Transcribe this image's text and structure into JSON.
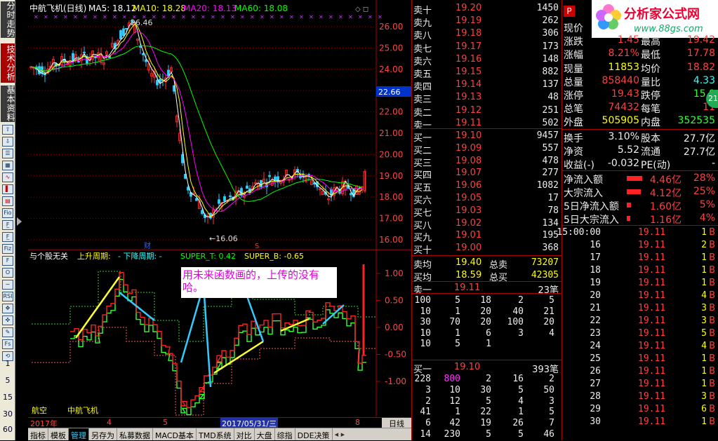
{
  "sidebar": {
    "tab_fenshi": "分时走势",
    "tab_jishu": "技术分析",
    "tab_jiben": "基本资料",
    "icons": [
      "up-arrow-icon",
      "down-arrow-icon",
      "list-icon",
      "grid-icon",
      "trend-icon",
      "candle-icon",
      "calculator-icon",
      "fio-icon",
      "fo-icon",
      "f-icon",
      "fiz-icon",
      "f-chart-icon",
      "circle-icon",
      "wave-icon",
      "rsi-icon",
      "cross-icon",
      "cross2-icon",
      "pencil-icon",
      "fs-icon",
      "refresh-icon"
    ],
    "icon_labels": [
      "⇧",
      "⇩",
      "☰",
      "▦",
      "∿",
      "▌",
      "▤",
      "Fio",
      "F̲",
      "F̲",
      "Fiz",
      "F",
      "O",
      "∽",
      "RSI",
      "✥",
      "✜",
      "✎",
      "Fs",
      "⟲"
    ],
    "numbers": [
      "1",
      "5",
      "15",
      "30",
      "60"
    ]
  },
  "kline": {
    "title": "中航飞机(日线)",
    "ma5": "MA5: 18.12",
    "ma10": "MA10: 18.28",
    "ma20": "MA20: 18.13",
    "ma60": "MA60: 18.08",
    "colors": {
      "ma5": "#ffffff",
      "ma10": "#ffff00",
      "ma20": "#ff00ff",
      "ma60": "#00ff00"
    },
    "high_label": "26.46",
    "low_label": "←16.06",
    "current_price": "22.66",
    "y_ticks": [
      "26.00",
      "25.00",
      "24.00",
      "23.00",
      "22.00",
      "21.00",
      "20.00",
      "19.00",
      "18.00",
      "17.00",
      "16.00"
    ],
    "fin_marker": "财",
    "s_marker": "S"
  },
  "indicator": {
    "title": "与个股无关",
    "up_label": "上升周期:",
    "down_label": "- 下降周期: -",
    "super_t": "SUPER_T: 0.42",
    "super_b": "SUPER_B: -0.65",
    "y_ticks": [
      "1.00",
      "0.50",
      "0.00",
      "-0.50",
      "-1.00"
    ],
    "annotation": "用未来函数画的，上传的没有哈。",
    "sector": "航空",
    "stock": "中航飞机"
  },
  "ruler": {
    "year": "2017年",
    "m4": "4",
    "m5": "5",
    "date": "2017/05/31/三",
    "m8": "8",
    "period": "日线"
  },
  "tabs": [
    "指标",
    "模板",
    "管理",
    "另存为",
    "私募数据",
    "MACD基本",
    "TMD系统",
    "对比",
    "大盘",
    "综指",
    "DDE决策"
  ],
  "active_tab": "管理",
  "orderbook": {
    "asks": [
      [
        "卖十",
        "19.20",
        "1450"
      ],
      [
        "卖九",
        "19.19",
        "262"
      ],
      [
        "卖八",
        "19.18",
        "306"
      ],
      [
        "卖七",
        "19.17",
        "173"
      ],
      [
        "卖六",
        "19.16",
        "148"
      ],
      [
        "卖五",
        "19.15",
        "882"
      ],
      [
        "卖四",
        "19.14",
        "137"
      ],
      [
        "卖三",
        "19.13",
        "48"
      ],
      [
        "卖二",
        "19.12",
        "251"
      ],
      [
        "卖一",
        "19.11",
        "502"
      ]
    ],
    "bids": [
      [
        "买一",
        "19.10",
        "9457"
      ],
      [
        "买二",
        "19.09",
        "557"
      ],
      [
        "买三",
        "19.08",
        "478"
      ],
      [
        "买四",
        "19.07",
        "277"
      ],
      [
        "买五",
        "19.06",
        "1082"
      ],
      [
        "买六",
        "19.05",
        "17"
      ],
      [
        "买七",
        "19.03",
        "78"
      ],
      [
        "买八",
        "19.02",
        "134"
      ],
      [
        "买九",
        "19.01",
        "195"
      ],
      [
        "买十",
        "19.00",
        "368"
      ]
    ],
    "avg_sell_label": "卖均",
    "avg_sell": "19.40",
    "total_sell_label": "总卖",
    "total_sell": "73207",
    "avg_buy_label": "买均",
    "avg_buy": "18.59",
    "total_buy_label": "总买",
    "total_buy": "42305",
    "ask1_label": "卖一",
    "ask1_price": "19.11",
    "ask1_count": "23笔",
    "ask1_queue": [
      [
        "100",
        "5",
        "18",
        "2",
        "5"
      ],
      [
        "10",
        "1",
        "20",
        "40",
        "21"
      ],
      [
        "30",
        "70",
        "20",
        "100",
        "20"
      ],
      [
        "10",
        "1",
        "6",
        "3",
        "4"
      ],
      [
        "10",
        "5",
        "1",
        "",
        ""
      ]
    ],
    "bid1_label": "买一",
    "bid1_price": "19.10",
    "bid1_count": "393笔",
    "bid1_queue": [
      [
        "228",
        "800",
        "2",
        "16",
        "2"
      ],
      [
        "3",
        "10",
        "30",
        "5",
        "50"
      ],
      [
        "2",
        "12",
        "5",
        "4",
        "3"
      ],
      [
        "41",
        "1",
        "22",
        "1",
        "5"
      ],
      [
        "6",
        "42",
        "19",
        "26",
        "7"
      ],
      [
        "14",
        "230",
        "5",
        "5",
        "46"
      ]
    ]
  },
  "quote": {
    "watermark_title": "分析家公式网",
    "watermark_url": "www.88gs.com",
    "p_badge": "P",
    "rows": [
      [
        "现价",
        "",
        "",
        ""
      ],
      [
        "涨跌",
        "1.45",
        "最高",
        "19.42"
      ],
      [
        "涨幅",
        "8.21%",
        "最低",
        "17.78"
      ],
      [
        "现量",
        "11853",
        "均价",
        "18.82"
      ],
      [
        "总量",
        "858440",
        "量比",
        "4.33"
      ],
      [
        "涨停",
        "19.43",
        "跌停",
        "15.9"
      ],
      [
        "总笔",
        "74432",
        "每笔",
        "11"
      ],
      [
        "外盘",
        "505905",
        "内盘",
        "352535"
      ]
    ],
    "rows2": [
      [
        "换手",
        "3.10%",
        "股本",
        "27.7亿"
      ],
      [
        "净资",
        "5.52",
        "流通",
        "27.7亿"
      ],
      [
        "收益(-)",
        "-0.032",
        "PE(动)",
        "-"
      ]
    ],
    "flows": [
      [
        "净流入额",
        "4.46亿",
        "28%"
      ],
      [
        "大宗流入",
        "4.12亿",
        "25%"
      ],
      [
        "5日净流入额",
        "1.60亿",
        "5%"
      ],
      [
        "5日大宗流入",
        "1.16亿",
        "4%"
      ]
    ],
    "circle_badge": "21",
    "ticks": [
      [
        "15:00:00",
        "19.11",
        "1",
        "B"
      ],
      [
        "16",
        "19.11",
        "2",
        "B"
      ],
      [
        "17",
        "19.11",
        "1",
        "B"
      ],
      [
        "18",
        "19.11",
        "1",
        "B"
      ],
      [
        "19",
        "19.11",
        "1",
        "B"
      ],
      [
        "20",
        "19.11",
        "4",
        "B"
      ],
      [
        "21",
        "19.11",
        "3",
        "B"
      ],
      [
        "22",
        "19.11",
        "3",
        "B"
      ],
      [
        "23",
        "19.11",
        "5",
        "B"
      ],
      [
        "24",
        "19.11",
        "4",
        "B"
      ],
      [
        "25",
        "19.11",
        "1",
        "B"
      ],
      [
        "26",
        "19.11",
        "1",
        "B"
      ],
      [
        "27",
        "19.11",
        "1",
        "B"
      ],
      [
        "28",
        "19.11",
        "3",
        "B"
      ],
      [
        "29",
        "19.11",
        "6",
        "B"
      ],
      [
        "30",
        "19.11",
        "1",
        "B"
      ]
    ]
  }
}
